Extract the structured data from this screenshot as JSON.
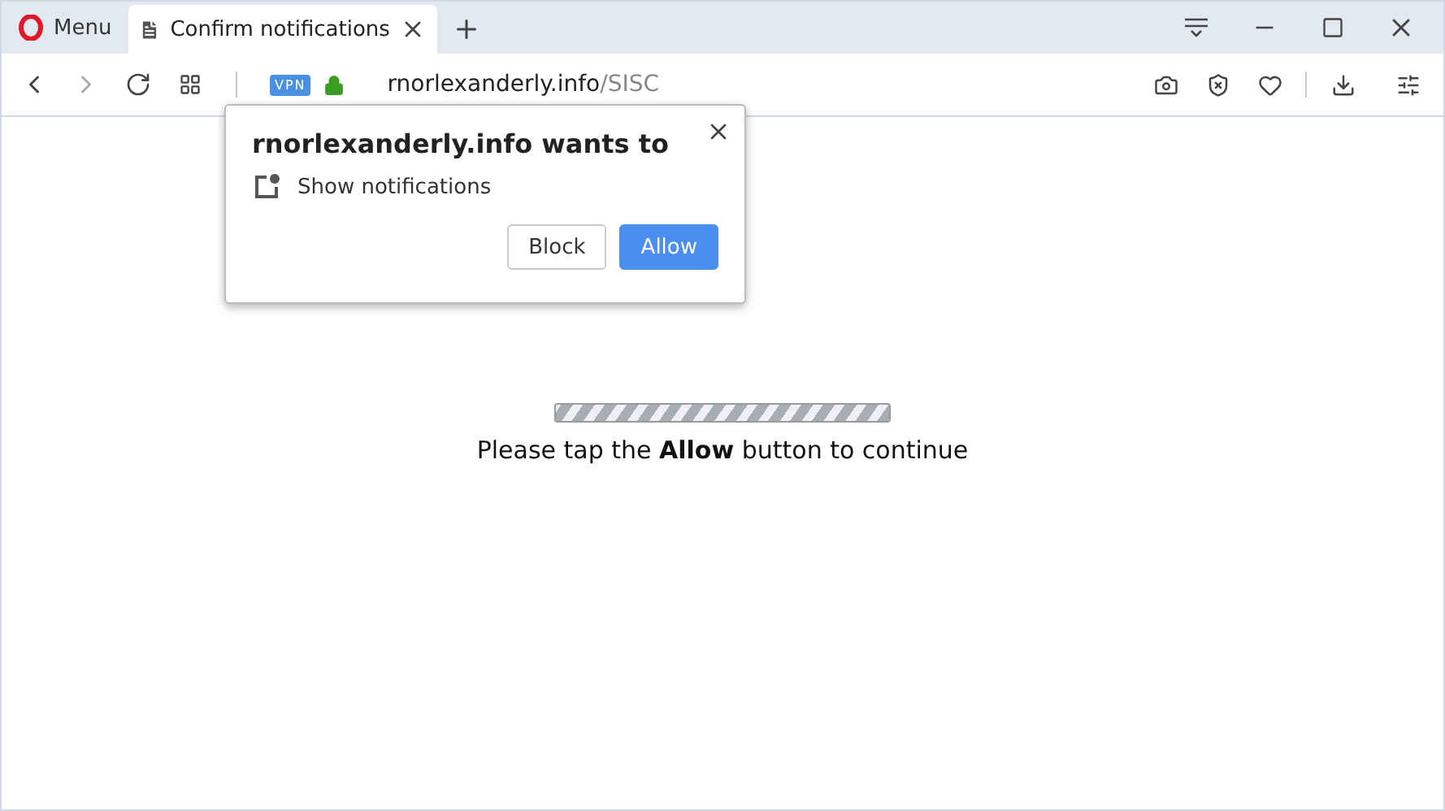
{
  "browser": {
    "menu_label": "Menu",
    "tabs": [
      {
        "title": "Confirm notifications",
        "selected": true
      }
    ],
    "vpn_badge": "VPN",
    "address": {
      "domain": "rnorlexanderly.info",
      "path": "/SISC"
    }
  },
  "permission_popup": {
    "title": "rnorlexanderly.info wants to",
    "permission": "Show notifications",
    "buttons": [
      {
        "label": "Block",
        "kind": "secondary"
      },
      {
        "label": "Allow",
        "kind": "primary"
      }
    ]
  },
  "page": {
    "progress": {
      "level": 1
    },
    "message": "Please tap the **Allow** button to continue"
  }
}
